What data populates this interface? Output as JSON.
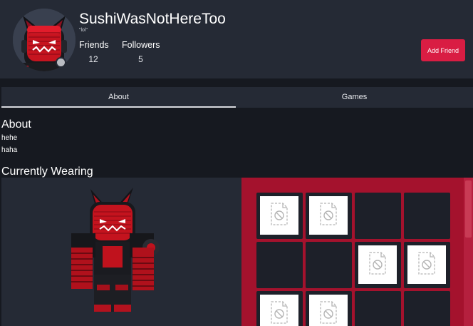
{
  "profile": {
    "username": "SushiWasNotHereToo",
    "status": "\"lol\"",
    "stats": [
      {
        "label": "Friends",
        "value": "12"
      },
      {
        "label": "Followers",
        "value": "5"
      }
    ],
    "add_friend_label": "Add Friend",
    "presence": "offline"
  },
  "tabs": [
    {
      "label": "About",
      "active": true
    },
    {
      "label": "Games",
      "active": false
    }
  ],
  "about": {
    "title": "About",
    "lines": [
      "hehe",
      "haha"
    ]
  },
  "wearing": {
    "title": "Currently Wearing",
    "items": [
      {
        "has_thumbnail": true,
        "icon": "broken-image-icon"
      },
      {
        "has_thumbnail": true,
        "icon": "broken-image-icon"
      },
      {
        "has_thumbnail": false
      },
      {
        "has_thumbnail": false
      },
      {
        "has_thumbnail": false
      },
      {
        "has_thumbnail": false
      },
      {
        "has_thumbnail": true,
        "icon": "broken-image-icon"
      },
      {
        "has_thumbnail": true,
        "icon": "broken-image-icon"
      },
      {
        "has_thumbnail": true,
        "icon": "broken-image-icon"
      },
      {
        "has_thumbnail": true,
        "icon": "broken-image-icon"
      },
      {
        "has_thumbnail": false
      },
      {
        "has_thumbnail": false
      }
    ]
  },
  "colors": {
    "page_bg": "#161920",
    "card_bg": "#252a35",
    "accent": "#d91d43",
    "items_bg": "#a4122d"
  }
}
